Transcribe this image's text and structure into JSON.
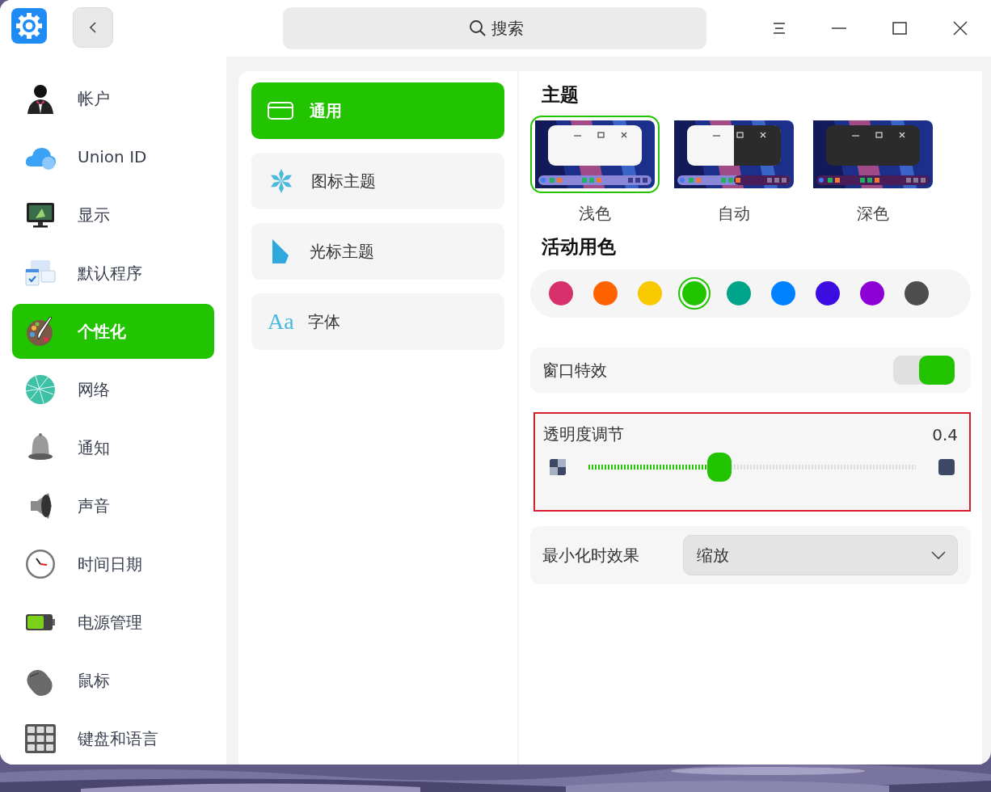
{
  "titlebar": {
    "search": {
      "placeholder": "搜索"
    }
  },
  "sidebar": {
    "items": [
      {
        "label": "帐户",
        "kind": "account",
        "selected": false
      },
      {
        "label": "Union ID",
        "kind": "cloud",
        "selected": false
      },
      {
        "label": "显示",
        "kind": "display",
        "selected": false
      },
      {
        "label": "默认程序",
        "kind": "apps",
        "selected": false
      },
      {
        "label": "个性化",
        "kind": "personalize",
        "selected": true
      },
      {
        "label": "网络",
        "kind": "network",
        "selected": false
      },
      {
        "label": "通知",
        "kind": "notify",
        "selected": false
      },
      {
        "label": "声音",
        "kind": "sound",
        "selected": false
      },
      {
        "label": "时间日期",
        "kind": "clock",
        "selected": false
      },
      {
        "label": "电源管理",
        "kind": "power",
        "selected": false
      },
      {
        "label": "鼠标",
        "kind": "mouse",
        "selected": false
      },
      {
        "label": "键盘和语言",
        "kind": "keyboard",
        "selected": false
      }
    ]
  },
  "subnav": {
    "items": [
      {
        "label": "通用",
        "kind": "general",
        "selected": true
      },
      {
        "label": "图标主题",
        "kind": "icons",
        "selected": false
      },
      {
        "label": "光标主题",
        "kind": "cursor",
        "selected": false
      },
      {
        "label": "字体",
        "kind": "font",
        "glyph": "Aa",
        "selected": false
      }
    ]
  },
  "theme": {
    "title": "主题",
    "options": [
      {
        "label": "浅色",
        "kind": "light",
        "selected": true
      },
      {
        "label": "自动",
        "kind": "auto",
        "selected": false
      },
      {
        "label": "深色",
        "kind": "dark",
        "selected": false
      }
    ]
  },
  "accent": {
    "title": "活动用色",
    "colors": [
      {
        "color": "#d8306b",
        "selected": false
      },
      {
        "color": "#ff6200",
        "selected": false
      },
      {
        "color": "#f8c800",
        "selected": false
      },
      {
        "color": "#22c400",
        "selected": true
      },
      {
        "color": "#00a48a",
        "selected": false
      },
      {
        "color": "#0081ff",
        "selected": false
      },
      {
        "color": "#3d0ce0",
        "selected": false
      },
      {
        "color": "#8c00d6",
        "selected": false
      },
      {
        "color": "#4d4d4d",
        "selected": false
      }
    ]
  },
  "window_effect": {
    "label": "窗口特效",
    "on": true
  },
  "transparency": {
    "label": "透明度调节",
    "reading": "0.4",
    "level": 0.4,
    "highlighted": true
  },
  "minimize_effect": {
    "label": "最小化时效果",
    "value": "缩放"
  }
}
